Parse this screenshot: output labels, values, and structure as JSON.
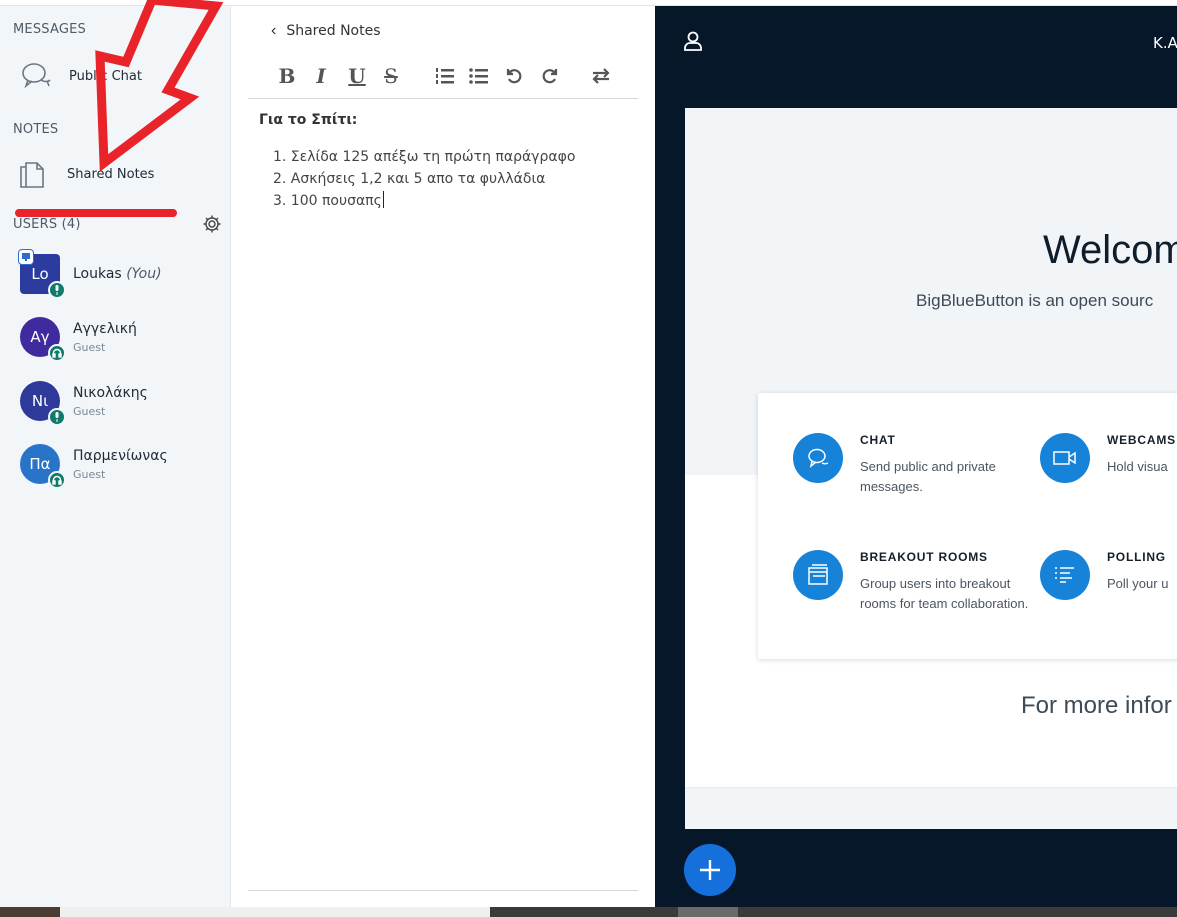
{
  "sidebar": {
    "messages_title": "MESSAGES",
    "public_chat_label": "Public Chat",
    "notes_title": "NOTES",
    "shared_notes_label": "Shared Notes",
    "users_title": "USERS (4)",
    "users": [
      {
        "initials": "Lo",
        "name": "Loukas",
        "you": "(You)",
        "role": "",
        "color": "#2b3c9e"
      },
      {
        "initials": "Αγ",
        "name": "Αγγελική",
        "you": "",
        "role": "Guest",
        "color": "#3f2b9e"
      },
      {
        "initials": "Νι",
        "name": "Νικολάκης",
        "you": "",
        "role": "Guest",
        "color": "#2d3a9a"
      },
      {
        "initials": "Πα",
        "name": "Παρμενίωνας",
        "you": "",
        "role": "Guest",
        "color": "#2874c8"
      }
    ]
  },
  "notes": {
    "back_label": "Shared Notes",
    "toolbar": {
      "bold": "B",
      "italic": "I",
      "underline": "U",
      "strike": "S"
    },
    "heading": "Για το Σπίτι:",
    "items": [
      "1. Σελίδα 125 απέξω τη πρώτη παράγραφο",
      "2. Ασκήσεις 1,2 και 5 απο τα φυλλάδια",
      "3. 100 πουσαπς"
    ]
  },
  "stage": {
    "meeting_name": "K.A",
    "welcome": "Welcom",
    "subtitle": "BigBlueButton is an open sourc",
    "features": [
      {
        "title": "CHAT",
        "desc": "Send public and private messages."
      },
      {
        "title": "WEBCAMS",
        "desc": "Hold visua"
      },
      {
        "title": "BREAKOUT ROOMS",
        "desc": "Group users into breakout rooms for team collaboration."
      },
      {
        "title": "POLLING",
        "desc": "Poll your u"
      }
    ],
    "more_info": "For more infor"
  },
  "colors": {
    "accent": "#1783d8",
    "stage_bg": "#06172a",
    "annotation": "#e8232a"
  }
}
